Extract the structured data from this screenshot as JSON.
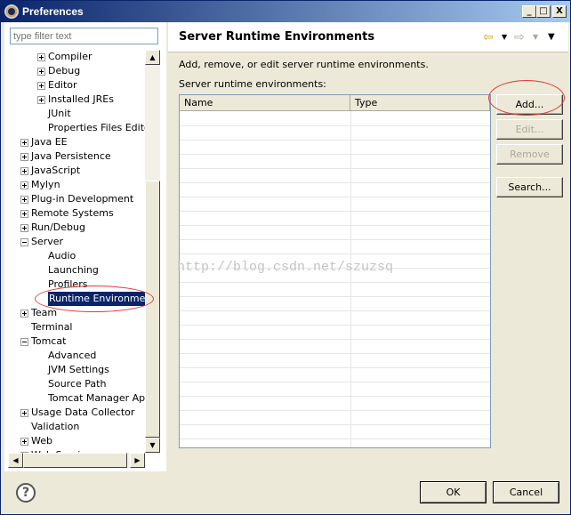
{
  "window": {
    "title": "Preferences",
    "min": "_",
    "max": "□",
    "close": "X"
  },
  "filter": {
    "placeholder": "type filter text"
  },
  "tree": [
    {
      "label": "Compiler",
      "indent": 2,
      "exp": "plus"
    },
    {
      "label": "Debug",
      "indent": 2,
      "exp": "plus"
    },
    {
      "label": "Editor",
      "indent": 2,
      "exp": "plus"
    },
    {
      "label": "Installed JREs",
      "indent": 2,
      "exp": "plus"
    },
    {
      "label": "JUnit",
      "indent": 2,
      "exp": "none"
    },
    {
      "label": "Properties Files Editor",
      "indent": 2,
      "exp": "none"
    },
    {
      "label": "Java EE",
      "indent": 1,
      "exp": "plus"
    },
    {
      "label": "Java Persistence",
      "indent": 1,
      "exp": "plus"
    },
    {
      "label": "JavaScript",
      "indent": 1,
      "exp": "plus"
    },
    {
      "label": "Mylyn",
      "indent": 1,
      "exp": "plus"
    },
    {
      "label": "Plug-in Development",
      "indent": 1,
      "exp": "plus"
    },
    {
      "label": "Remote Systems",
      "indent": 1,
      "exp": "plus"
    },
    {
      "label": "Run/Debug",
      "indent": 1,
      "exp": "plus"
    },
    {
      "label": "Server",
      "indent": 1,
      "exp": "minus"
    },
    {
      "label": "Audio",
      "indent": 2,
      "exp": "none"
    },
    {
      "label": "Launching",
      "indent": 2,
      "exp": "none"
    },
    {
      "label": "Profilers",
      "indent": 2,
      "exp": "none"
    },
    {
      "label": "Runtime Environments",
      "indent": 2,
      "exp": "none",
      "selected": true
    },
    {
      "label": "Team",
      "indent": 1,
      "exp": "plus"
    },
    {
      "label": "Terminal",
      "indent": 1,
      "exp": "none"
    },
    {
      "label": "Tomcat",
      "indent": 1,
      "exp": "minus"
    },
    {
      "label": "Advanced",
      "indent": 2,
      "exp": "none"
    },
    {
      "label": "JVM Settings",
      "indent": 2,
      "exp": "none"
    },
    {
      "label": "Source Path",
      "indent": 2,
      "exp": "none"
    },
    {
      "label": "Tomcat Manager App",
      "indent": 2,
      "exp": "none"
    },
    {
      "label": "Usage Data Collector",
      "indent": 1,
      "exp": "plus"
    },
    {
      "label": "Validation",
      "indent": 1,
      "exp": "none"
    },
    {
      "label": "Web",
      "indent": 1,
      "exp": "plus"
    },
    {
      "label": "Web Services",
      "indent": 1,
      "exp": "plus"
    }
  ],
  "page": {
    "title": "Server Runtime Environments",
    "description": "Add, remove, or edit server runtime environments.",
    "table_label": "Server runtime environments:",
    "columns": [
      "Name",
      "Type"
    ]
  },
  "buttons": {
    "add": "Add...",
    "edit": "Edit...",
    "remove": "Remove",
    "search": "Search..."
  },
  "footer": {
    "help": "?",
    "ok": "OK",
    "cancel": "Cancel"
  },
  "watermark": "http://blog.csdn.net/szuzsq",
  "colors": {
    "selection": "#0a246a",
    "annotation_ring": "#e23b3b"
  }
}
